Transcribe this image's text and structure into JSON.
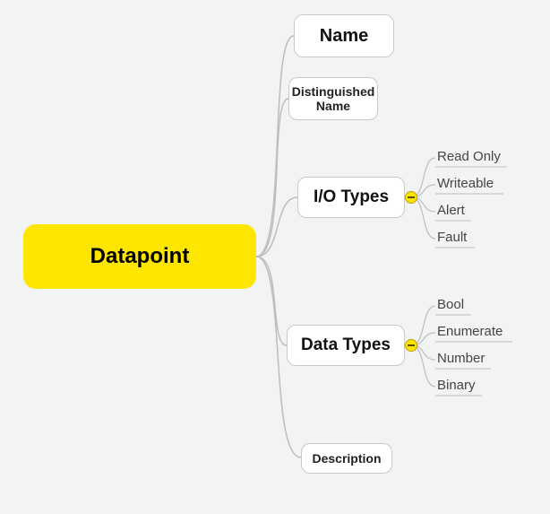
{
  "root": {
    "label": "Datapoint"
  },
  "level1": {
    "name": {
      "label": "Name"
    },
    "dname": {
      "label": "Distinguished Name"
    },
    "io": {
      "label": "I/O Types"
    },
    "dtypes": {
      "label": "Data Types"
    },
    "desc": {
      "label": "Description"
    }
  },
  "io_children": {
    "a": "Read Only",
    "b": "Writeable",
    "c": "Alert",
    "d": "Fault"
  },
  "dtype_children": {
    "a": "Bool",
    "b": "Enumerate",
    "c": "Number",
    "d": "Binary"
  },
  "colors": {
    "accent": "#ffe600",
    "bg": "#f2f3f5",
    "node_border": "#c9c9c9",
    "line": "#bdbdbd"
  }
}
